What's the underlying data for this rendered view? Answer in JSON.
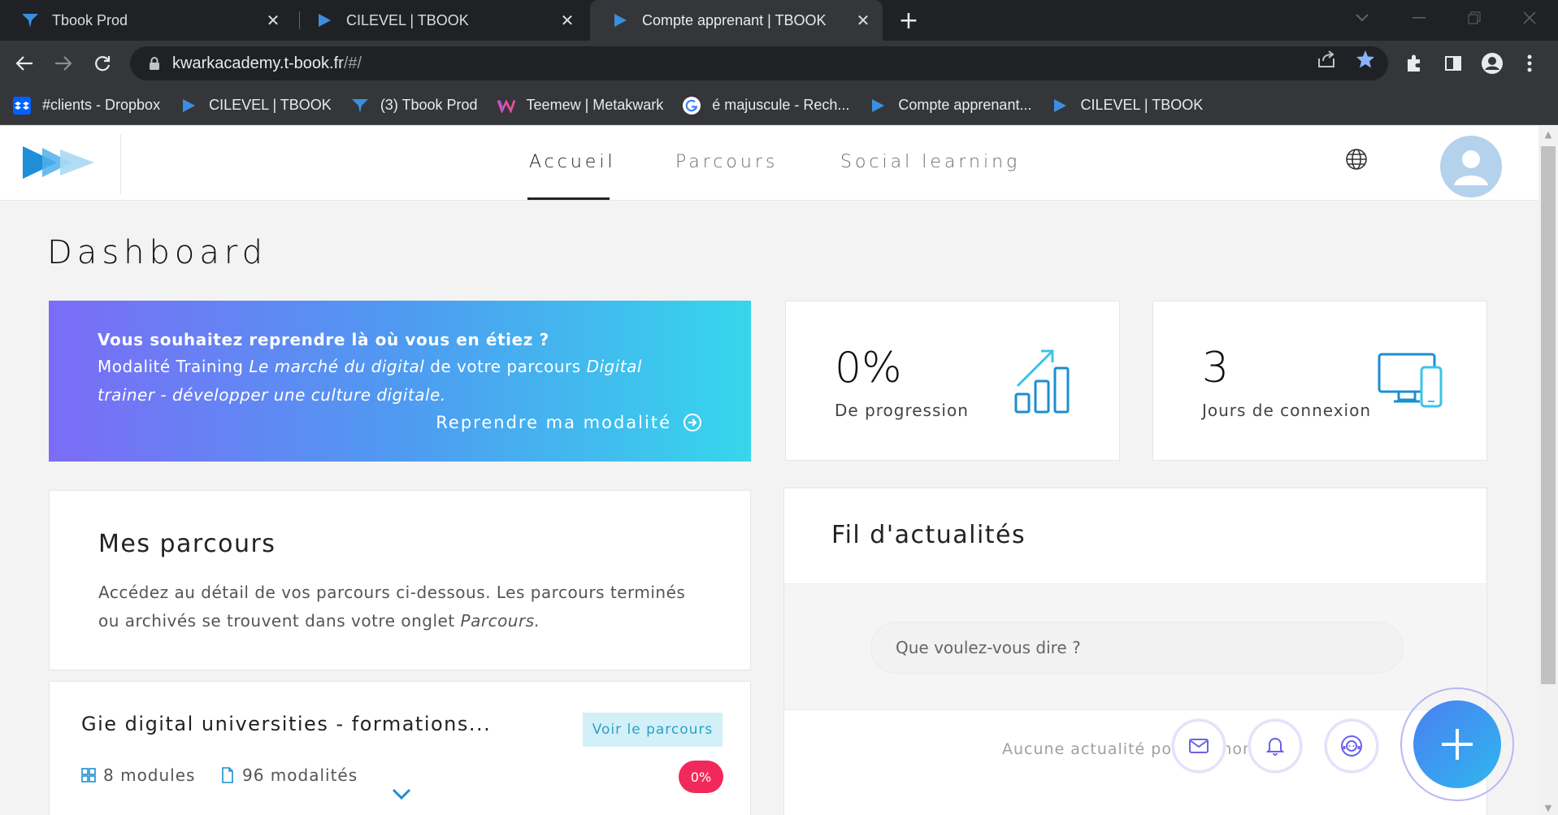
{
  "browser": {
    "tabs": [
      {
        "title": "Tbook Prod",
        "icon": "tbook-funnel-icon",
        "active": false
      },
      {
        "title": "CILEVEL | TBOOK",
        "icon": "tbook-play-icon",
        "active": false
      },
      {
        "title": "Compte apprenant | TBOOK",
        "icon": "tbook-play-icon",
        "active": true
      }
    ],
    "url": {
      "host": "kwarkacademy.t-book.fr",
      "path": "/#/"
    },
    "bookmarks": [
      {
        "label": "#clients - Dropbox",
        "icon": "dropbox-icon"
      },
      {
        "label": "CILEVEL | TBOOK",
        "icon": "tbook-play-icon"
      },
      {
        "label": "(3) Tbook Prod",
        "icon": "tbook-funnel-icon"
      },
      {
        "label": "Teemew | Metakwark",
        "icon": "teemew-icon"
      },
      {
        "label": "é majuscule - Rech...",
        "icon": "google-icon"
      },
      {
        "label": "Compte apprenant...",
        "icon": "tbook-play-icon"
      },
      {
        "label": "CILEVEL | TBOOK",
        "icon": "tbook-play-icon"
      }
    ]
  },
  "header": {
    "nav": [
      "Accueil",
      "Parcours",
      "Social learning"
    ],
    "active_nav": "Accueil"
  },
  "dashboard": {
    "title": "Dashboard",
    "resume": {
      "title": "Vous souhaitez reprendre là où vous en étiez ?",
      "text_prefix": "Modalité Training ",
      "modality": "Le marché du digital",
      "text_middle": " de votre parcours ",
      "course": "Digital trainer - développer une culture digitale.",
      "link": "Reprendre ma modalité"
    },
    "stats": {
      "progress": {
        "value": "0%",
        "label": "De progression"
      },
      "connection": {
        "value": "3",
        "label": "Jours de connexion"
      }
    },
    "mes_parcours": {
      "title": "Mes parcours",
      "description": "Accédez au détail de vos parcours ci-dessous. Les parcours terminés ou archivés se trouvent dans votre onglet ",
      "description_link": "Parcours."
    },
    "course_card": {
      "title": "Gie digital universities - formations...",
      "button": "Voir le parcours",
      "modules": "8 modules",
      "modalities": "96 modalités",
      "progress_badge": "0%"
    },
    "news": {
      "title": "Fil d'actualités",
      "placeholder": "Que voulez-vous dire ?",
      "empty": "Aucune actualité pour le moment"
    }
  },
  "colors": {
    "accent_blue": "#1a8fd0",
    "gradient_start": "#7b6cf6",
    "gradient_end": "#36d6ec",
    "badge_red": "#f1295b"
  }
}
